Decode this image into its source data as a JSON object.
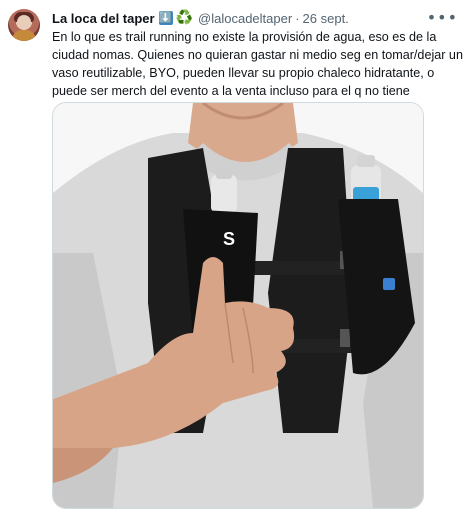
{
  "tweet": {
    "author_name": "La loca del taper",
    "emoji_badges": [
      "⬇️",
      "♻️"
    ],
    "handle": "@lalocadeltaper",
    "separator": "·",
    "date": "26 sept.",
    "more_icon": "•••",
    "text": "En lo que es trail running no existe la provisión de agua, eso es de la ciudad nomas. Quienes no quieran gastar ni medio seg en tomar/dejar un vaso reutilizable, BYO, pueden llevar su propio chaleco hidratante, o puede ser merch del evento a la venta incluso para el q no tiene",
    "media": {
      "description_icon": "photo",
      "logo_text": "S"
    }
  }
}
